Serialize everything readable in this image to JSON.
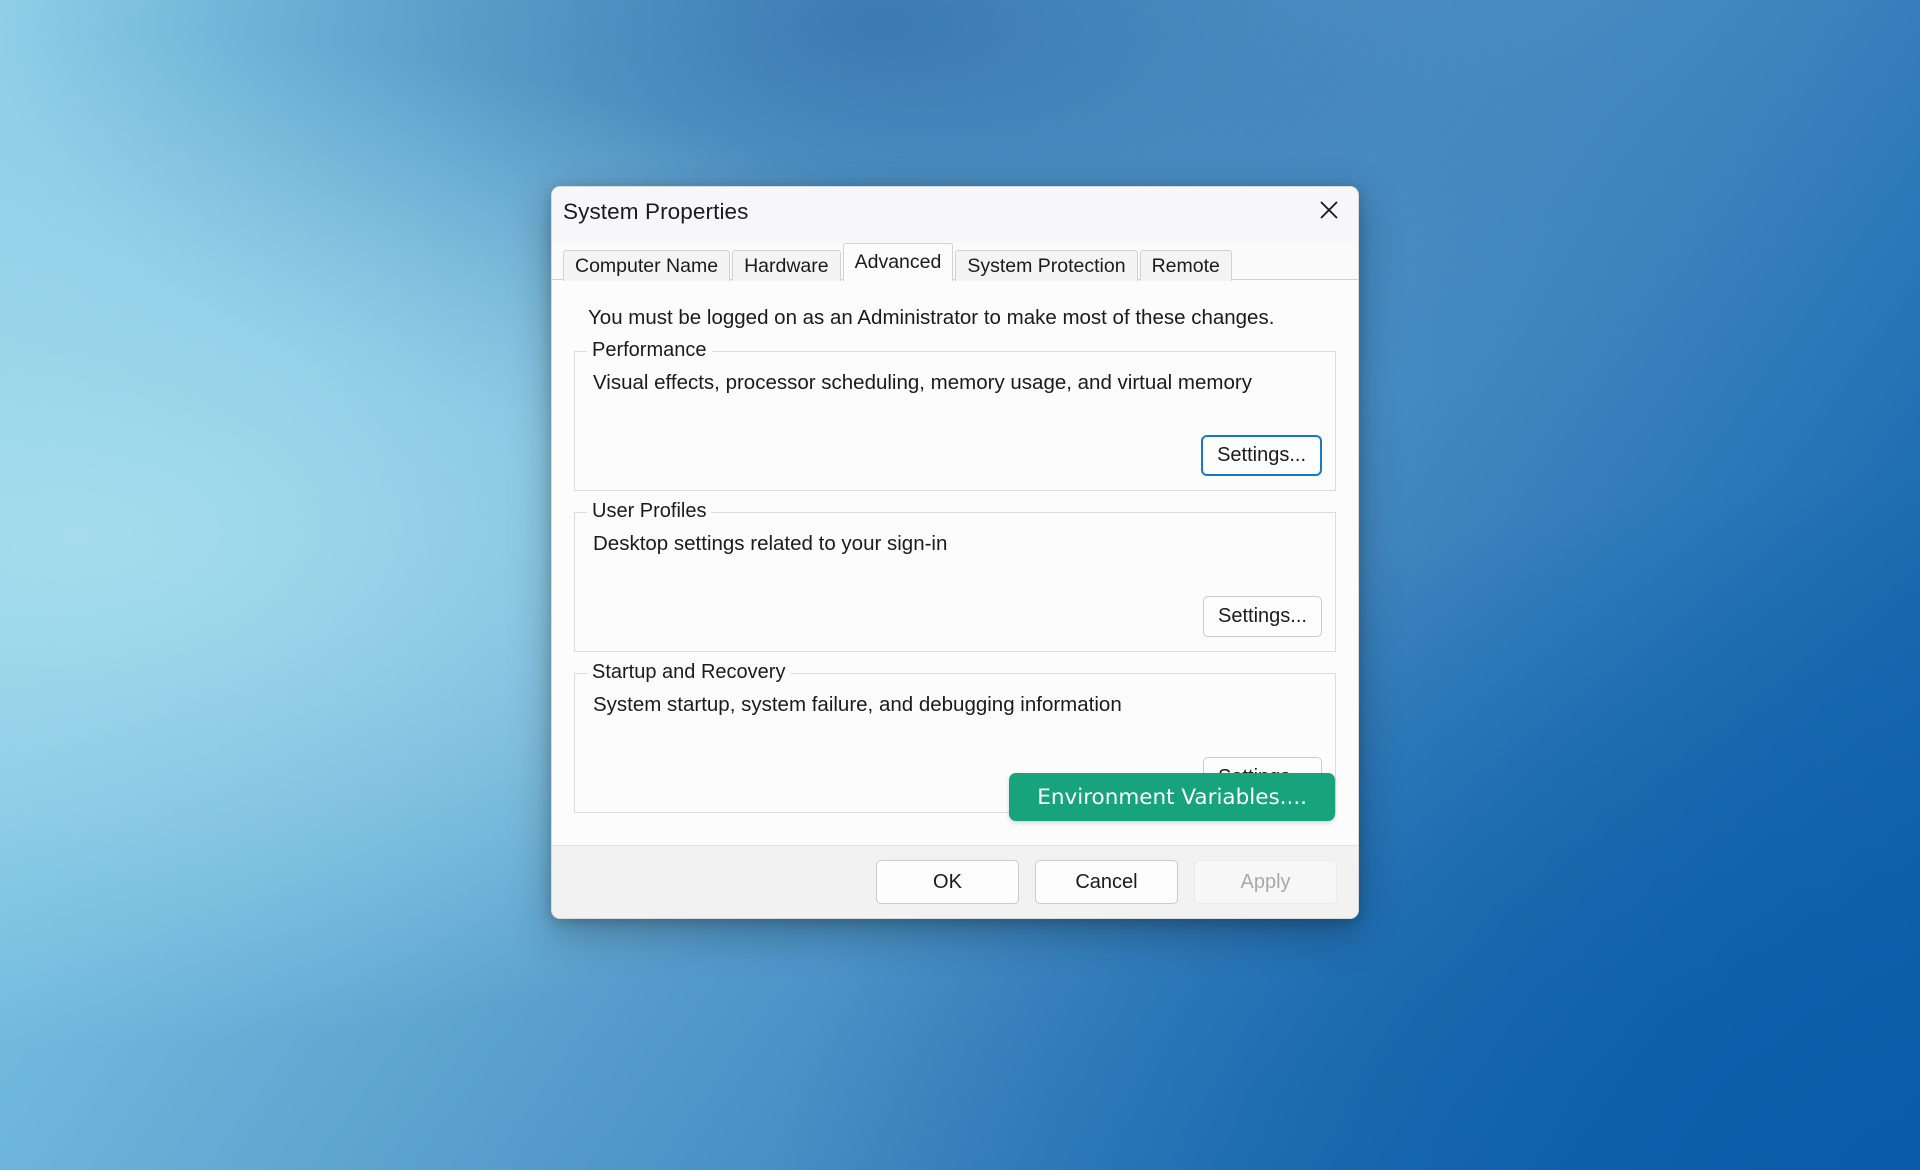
{
  "window": {
    "title": "System Properties",
    "close_icon": "close-icon"
  },
  "tabs": [
    {
      "label": "Computer Name",
      "active": false
    },
    {
      "label": "Hardware",
      "active": false
    },
    {
      "label": "Advanced",
      "active": true
    },
    {
      "label": "System Protection",
      "active": false
    },
    {
      "label": "Remote",
      "active": false
    }
  ],
  "content": {
    "notice": "You must be logged on as an Administrator to make most of these changes.",
    "groups": [
      {
        "label": "Performance",
        "description": "Visual effects, processor scheduling, memory usage, and virtual memory",
        "button_label": "Settings...",
        "focused": true
      },
      {
        "label": "User Profiles",
        "description": "Desktop settings related to your sign-in",
        "button_label": "Settings...",
        "focused": false
      },
      {
        "label": "Startup and Recovery",
        "description": "System startup, system failure, and debugging information",
        "button_label": "Settings...",
        "focused": false
      }
    ],
    "environment_variables_label": "Environment Variables...."
  },
  "footer": {
    "ok_label": "OK",
    "cancel_label": "Cancel",
    "apply_label": "Apply"
  },
  "colors": {
    "accent_green": "#17a47c",
    "focus_blue": "#1878c8",
    "dialog_background": "#fcfcfc",
    "footer_background": "#f2f2f2"
  }
}
